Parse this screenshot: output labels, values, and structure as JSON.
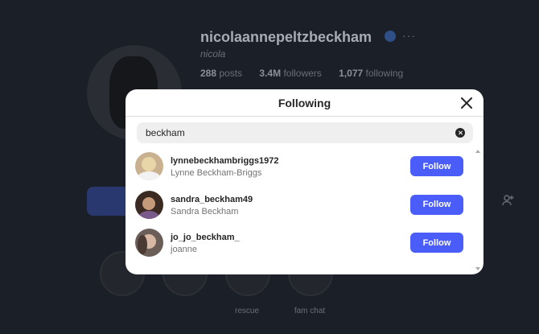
{
  "profile": {
    "username": "nicolaannepeltzbeckham",
    "display_name": "nicola",
    "stats": {
      "posts": "288",
      "posts_label": "posts",
      "followers": "3.4M",
      "followers_label": "followers",
      "following": "1,077",
      "following_label": "following"
    },
    "more_label": "···",
    "highlights": [
      "",
      "",
      "rescue",
      "fam chat"
    ]
  },
  "modal": {
    "title": "Following",
    "search": {
      "value": "beckham",
      "placeholder": "Search"
    },
    "users": [
      {
        "username": "lynnebeckhambriggs1972",
        "full_name": "Lynne Beckham-Briggs",
        "button": "Follow"
      },
      {
        "username": "sandra_beckham49",
        "full_name": "Sandra Beckham",
        "button": "Follow"
      },
      {
        "username": "jo_jo_beckham_",
        "full_name": "joanne",
        "button": "Follow"
      }
    ]
  },
  "colors": {
    "accent": "#4a5df9",
    "overlay": "#1b1f27"
  }
}
